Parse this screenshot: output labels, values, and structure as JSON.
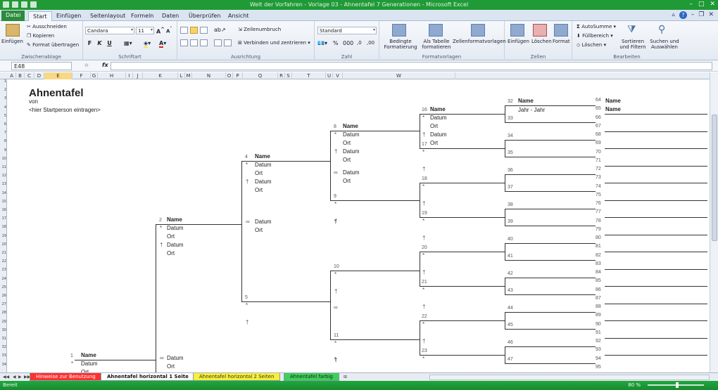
{
  "window": {
    "title": "Welt der Vorfahren - Vorlage 03 - Ahnentafel 7 Generationen - Microsoft Excel"
  },
  "ribbon_tabs": [
    "Datei",
    "Start",
    "Einfügen",
    "Seitenlayout",
    "Formeln",
    "Daten",
    "Überprüfen",
    "Ansicht"
  ],
  "ribbon": {
    "clipboard": {
      "paste": "Einfügen",
      "cut": "Ausschneiden",
      "copy": "Kopieren",
      "format_painter": "Format übertragen",
      "label": "Zwischenablage"
    },
    "font": {
      "name": "Candara",
      "size": "11",
      "label": "Schriftart",
      "bold": "F",
      "italic": "K",
      "underline": "U"
    },
    "alignment": {
      "wrap": "Zeilenumbruch",
      "merge": "Verbinden und zentrieren",
      "label": "Ausrichtung"
    },
    "number": {
      "format": "Standard",
      "label": "Zahl"
    },
    "styles": {
      "conditional": "Bedingte Formatierung",
      "as_table": "Als Tabelle formatieren",
      "cell_styles": "Zellenformatvorlagen",
      "label": "Formatvorlagen"
    },
    "cells": {
      "insert": "Einfügen",
      "delete": "Löschen",
      "format": "Format",
      "label": "Zellen"
    },
    "editing": {
      "autosum": "AutoSumme",
      "fill": "Füllbereich",
      "clear": "Löschen",
      "sort": "Sortieren und Filtern",
      "find": "Suchen und Auswählen",
      "label": "Bearbeiten"
    }
  },
  "formula_bar": {
    "name_box": "E48",
    "fx": "fx",
    "value": ""
  },
  "columns": [
    "A",
    "B",
    "C",
    "D",
    "E",
    "F",
    "G",
    "H",
    "I",
    "J",
    "K",
    "L",
    "M",
    "N",
    "O",
    "P",
    "Q",
    "R",
    "S",
    "T",
    "U",
    "V",
    "W"
  ],
  "selected_column": "E",
  "rows": [
    "1",
    "2",
    "3",
    "4",
    "5",
    "6",
    "7",
    "8",
    "9",
    "10",
    "11",
    "12",
    "13",
    "14",
    "15",
    "16",
    "17",
    "18",
    "19",
    "20",
    "21",
    "22",
    "23",
    "24",
    "25",
    "26",
    "27",
    "28",
    "29",
    "30",
    "31",
    "32",
    "33",
    "34"
  ],
  "sheet": {
    "title": "Ahnentafel",
    "von": "von",
    "start_hint": "<hier Startperson eintragen>",
    "name": "Name",
    "datum": "Datum",
    "ort": "Ort",
    "jahr": "Jahr - Jahr",
    "birth": "*",
    "death": "†",
    "marriage": "∞"
  },
  "ancestor_numbers": [
    "1",
    "2",
    "4",
    "5",
    "8",
    "9",
    "10",
    "11",
    "16",
    "17",
    "18",
    "19",
    "20",
    "21",
    "22",
    "23",
    "32",
    "33",
    "34",
    "35",
    "36",
    "37",
    "38",
    "39",
    "40",
    "41",
    "42",
    "43",
    "44",
    "45",
    "46",
    "47",
    "64",
    "65",
    "66",
    "67",
    "68",
    "69",
    "70",
    "71",
    "72",
    "73",
    "74",
    "75",
    "76",
    "77",
    "78",
    "79",
    "80",
    "81",
    "82",
    "83",
    "84",
    "85",
    "86",
    "87",
    "88",
    "89",
    "90",
    "91",
    "92",
    "93",
    "94",
    "95"
  ],
  "sheet_tabs": [
    "Hinweise zur Benutzung",
    "Ahnentafel horizontal 1 Seite",
    "Ahnentafel horizontal 2 Seiten",
    "Ahnentafel farbig"
  ],
  "status": {
    "ready": "Bereit",
    "zoom": "80 %"
  }
}
